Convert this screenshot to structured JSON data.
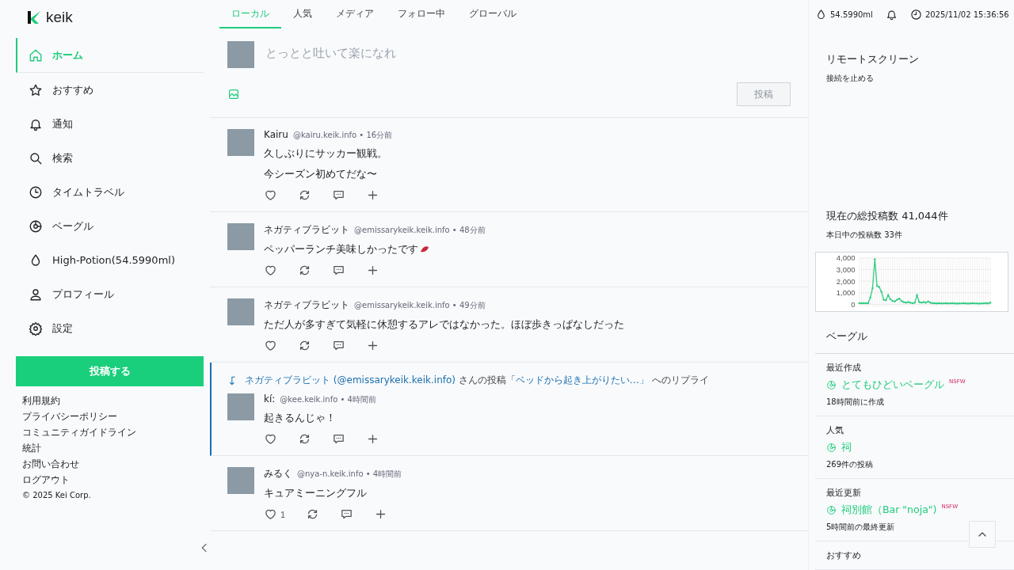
{
  "logo": {
    "text": "keik"
  },
  "nav": [
    {
      "kind": "home",
      "label": "ホーム",
      "selected": true
    },
    {
      "kind": "star",
      "label": "おすすめ",
      "selected": false
    },
    {
      "kind": "bell",
      "label": "通知",
      "selected": false
    },
    {
      "kind": "search",
      "label": "検索",
      "selected": false
    },
    {
      "kind": "clock",
      "label": "タイムトラベル",
      "selected": false
    },
    {
      "kind": "bagel",
      "label": "ベーグル",
      "selected": false
    },
    {
      "kind": "drop",
      "label": "High-Potion(54.5990ml)",
      "selected": false
    },
    {
      "kind": "person",
      "label": "プロフィール",
      "selected": false
    },
    {
      "kind": "gear",
      "label": "設定",
      "selected": false
    }
  ],
  "post_button": "投稿する",
  "footer_links": [
    "利用規約",
    "プライバシーポリシー",
    "コミュニティガイドライン",
    "統計",
    "お問い合わせ",
    "ログアウト"
  ],
  "copyright": "© 2025 Kei Corp.",
  "tabs": [
    {
      "label": "ローカル",
      "selected": true
    },
    {
      "label": "人気",
      "selected": false
    },
    {
      "label": "メディア",
      "selected": false
    },
    {
      "label": "フォロー中",
      "selected": false
    },
    {
      "label": "グローバル",
      "selected": false
    }
  ],
  "composer": {
    "placeholder": "とっとと吐いて楽になれ",
    "submit": "投稿"
  },
  "posts": [
    {
      "name": "Kairu",
      "meta": "@kairu.keik.info • 16分前",
      "lines": [
        "久しぶりにサッカー観戦。",
        "今シーズン初めてだな〜"
      ]
    },
    {
      "name": "ネガティブラビット",
      "meta": "@emissarykeik.keik.info • 48分前",
      "lines": [
        "ペッパーランチ美味しかったです"
      ],
      "emoji": true
    },
    {
      "name": "ネガティブラビット",
      "meta": "@emissarykeik.keik.info • 49分前",
      "lines": [
        "ただ人が多すぎて気軽に休憩するアレではなかった。ほぼ歩きっぱなしだった"
      ]
    },
    {
      "reply_to": {
        "user": "ネガティブラビット",
        "handle": "(@emissarykeik.keik.info)",
        "middle": "さんの投稿",
        "quote": "「ベッドから起き上がりたい…」",
        "tail": "へのリプライ"
      },
      "name": "kí:",
      "meta": "@kee.keik.info • 4時間前",
      "lines": [
        "起きるんじゃ！"
      ]
    },
    {
      "name": "みるく",
      "meta": "@nya-n.keik.info • 4時間前",
      "lines": [
        "キュアミーニングフル"
      ],
      "likes": "1"
    }
  ],
  "header": {
    "potion": "54.5990ml",
    "datetime": "2025/11/02 15:36:56"
  },
  "remote": {
    "title": "リモートスクリーン",
    "action": "接続を止める"
  },
  "stats": {
    "title": "現在の総投稿数 41,044件",
    "today": "本日中の投稿数 33件",
    "chart_data": {
      "type": "line",
      "grid": true,
      "ylim": [
        0,
        4000
      ],
      "yticks": [
        {
          "value": 0,
          "label": "0"
        },
        {
          "value": 1000,
          "label": "1,000"
        },
        {
          "value": 2000,
          "label": "2,000"
        },
        {
          "value": 3000,
          "label": "3,000"
        },
        {
          "value": 4000,
          "label": "4,000"
        }
      ],
      "series": [
        {
          "color": "#2ecc80",
          "values": [
            100,
            100,
            100,
            100,
            100,
            600,
            1400,
            3900,
            1600,
            1500,
            1100,
            400,
            350,
            800,
            450,
            300,
            250,
            400,
            500,
            300,
            200,
            150,
            200,
            150,
            100,
            150,
            800,
            200,
            150,
            200,
            150,
            250,
            150,
            100,
            100,
            80,
            100,
            80,
            90,
            100,
            80,
            90,
            100,
            80,
            70,
            80,
            90,
            100,
            80,
            70,
            80,
            100,
            90,
            80,
            70,
            80,
            90,
            100,
            80,
            150
          ]
        }
      ]
    }
  },
  "bagel": {
    "title": "ベーグル",
    "sections": [
      {
        "heading": "最近作成",
        "name": "とてもひどいベーグル",
        "badge": "NSFW",
        "meta": "18時間前に作成"
      },
      {
        "heading": "人気",
        "name": "祠",
        "meta": "269件の投稿"
      },
      {
        "heading": "最近更新",
        "name": "祠別館（Bar \"noja\")",
        "badge": "NSFW",
        "meta": "5時間前の最終更新"
      },
      {
        "heading": "おすすめ"
      }
    ]
  }
}
